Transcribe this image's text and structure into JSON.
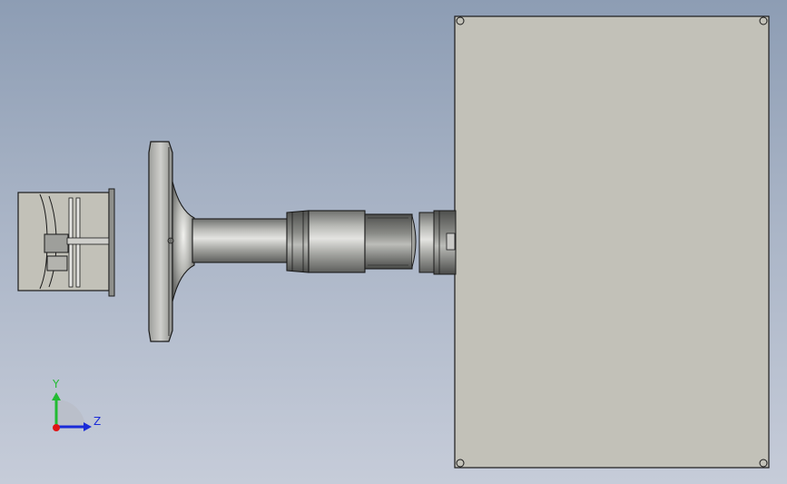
{
  "viewport": {
    "model": "cad-part-front-view"
  },
  "triad": {
    "y_label": "Y",
    "z_label": "Z",
    "colors": {
      "y": "#22bb33",
      "z": "#1a2bd8",
      "x": "#e01515"
    }
  },
  "colors": {
    "plate_fill": "#c2c1b8",
    "metal_light": "#d6d6d3",
    "metal_dark": "#6f706e",
    "outline": "#1a1a1a"
  }
}
